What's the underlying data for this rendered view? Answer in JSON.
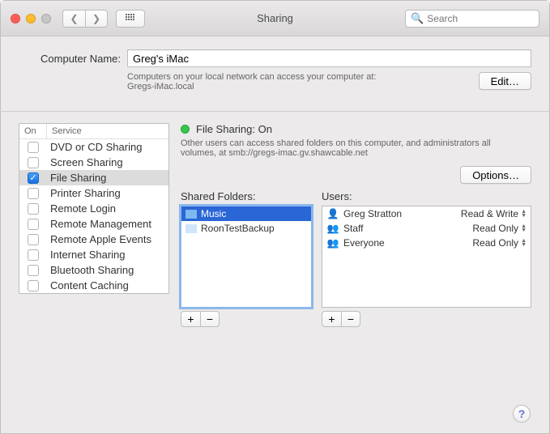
{
  "window": {
    "title": "Sharing"
  },
  "search": {
    "placeholder": "Search"
  },
  "computer_name": {
    "label": "Computer Name:",
    "value": "Greg's iMac",
    "hint_line1": "Computers on your local network can access your computer at:",
    "hint_line2": "Gregs-iMac.local",
    "edit": "Edit…"
  },
  "services": {
    "col_on": "On",
    "col_service": "Service",
    "items": [
      {
        "label": "DVD or CD Sharing",
        "checked": false
      },
      {
        "label": "Screen Sharing",
        "checked": false
      },
      {
        "label": "File Sharing",
        "checked": true,
        "selected": true
      },
      {
        "label": "Printer Sharing",
        "checked": false
      },
      {
        "label": "Remote Login",
        "checked": false
      },
      {
        "label": "Remote Management",
        "checked": false
      },
      {
        "label": "Remote Apple Events",
        "checked": false
      },
      {
        "label": "Internet Sharing",
        "checked": false
      },
      {
        "label": "Bluetooth Sharing",
        "checked": false
      },
      {
        "label": "Content Caching",
        "checked": false
      }
    ]
  },
  "status": {
    "title": "File Sharing: On",
    "desc": "Other users can access shared folders on this computer, and administrators all volumes, at smb://gregs-imac.gv.shawcable.net"
  },
  "options_button": "Options…",
  "shared_folders": {
    "title": "Shared Folders:",
    "items": [
      {
        "name": "Music",
        "selected": true
      },
      {
        "name": "RoonTestBackup",
        "selected": false
      }
    ]
  },
  "users": {
    "title": "Users:",
    "items": [
      {
        "name": "Greg Stratton",
        "perm": "Read & Write",
        "icon": "person"
      },
      {
        "name": "Staff",
        "perm": "Read Only",
        "icon": "group"
      },
      {
        "name": "Everyone",
        "perm": "Read Only",
        "icon": "group"
      }
    ]
  }
}
